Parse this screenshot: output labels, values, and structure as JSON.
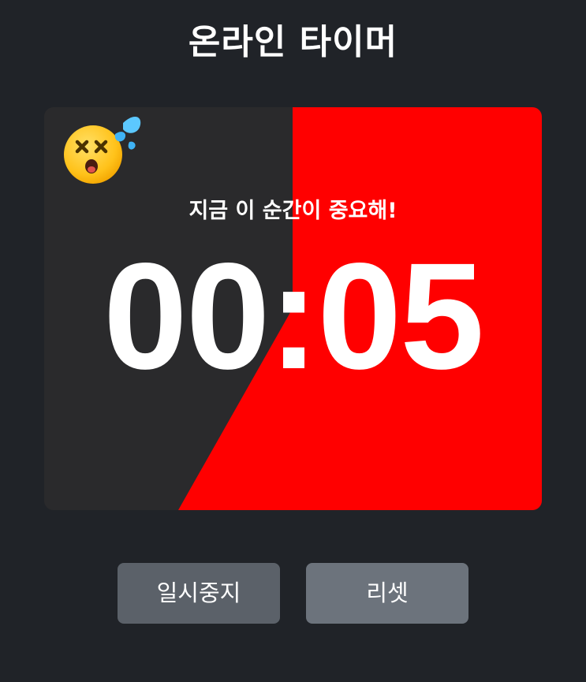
{
  "title": "온라인 타이머",
  "timer": {
    "message": "지금 이 순간이 중요해!",
    "time": "00:05",
    "remaining_fraction": 0.62,
    "colors": {
      "elapsed": "#2a2a2c",
      "remaining": "#ff0000"
    },
    "emoji_icon": "dizzy-face-sweat-icon"
  },
  "controls": {
    "pause_label": "일시중지",
    "reset_label": "리셋"
  }
}
